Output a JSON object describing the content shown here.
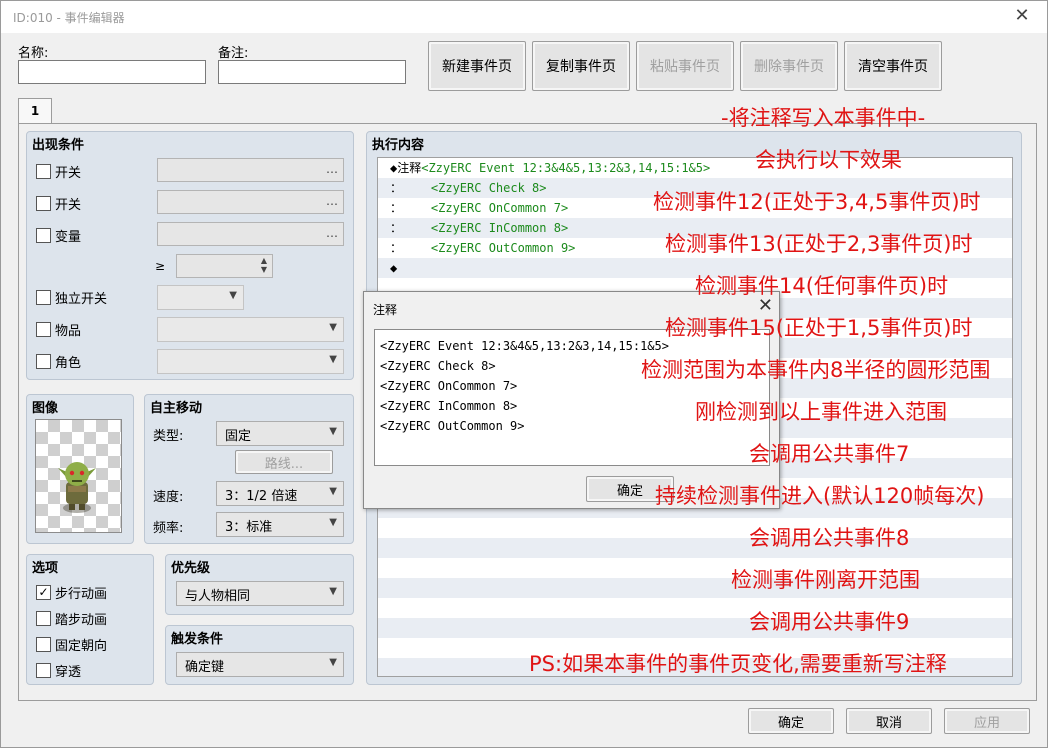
{
  "window": {
    "title": "ID:010 - 事件编辑器"
  },
  "fields": {
    "name_label": "名称:",
    "name_value": "",
    "memo_label": "备注:",
    "memo_value": ""
  },
  "page_buttons": {
    "new": "新建事件页",
    "copy": "复制事件页",
    "paste": "粘贴事件页",
    "delete": "删除事件页",
    "clear": "清空事件页"
  },
  "tab": {
    "label": "1"
  },
  "conditions": {
    "title": "出现条件",
    "switch1": "开关",
    "switch2": "开关",
    "variable": "变量",
    "gte": "≥",
    "self_switch": "独立开关",
    "item": "物品",
    "actor": "角色"
  },
  "image": {
    "title": "图像"
  },
  "autonomous": {
    "title": "自主移动",
    "type_label": "类型:",
    "type_value": "固定",
    "route_button": "路线...",
    "speed_label": "速度:",
    "speed_value": "3：1/2 倍速",
    "freq_label": "频率:",
    "freq_value": "3：标准"
  },
  "options": {
    "title": "选项",
    "walking": "步行动画",
    "stepping": "踏步动画",
    "direction_fix": "固定朝向",
    "through": "穿透"
  },
  "priority": {
    "title": "优先级",
    "value": "与人物相同"
  },
  "trigger": {
    "title": "触发条件",
    "value": "确定键"
  },
  "contents": {
    "title": "执行内容",
    "lines": [
      {
        "head": "◆注释",
        "code": "<ZzyERC Event 12:3&4&5,13:2&3,14,15:1&5>"
      },
      {
        "head": "：    ",
        "code": "<ZzyERC Check 8>"
      },
      {
        "head": "：    ",
        "code": "<ZzyERC OnCommon 7>"
      },
      {
        "head": "：    ",
        "code": "<ZzyERC InCommon 8>"
      },
      {
        "head": "：    ",
        "code": "<ZzyERC OutCommon 9>"
      },
      {
        "head": "◆",
        "code": ""
      }
    ]
  },
  "dialog": {
    "title": "注释",
    "lines": [
      "<ZzyERC Event 12:3&4&5,13:2&3,14,15:1&5>",
      "<ZzyERC Check 8>",
      "<ZzyERC OnCommon 7>",
      "<ZzyERC InCommon 8>",
      "<ZzyERC OutCommon 9>"
    ],
    "ok": "确定"
  },
  "annotations": [
    "-将注释写入本事件中-",
    "会执行以下效果",
    "检测事件12(正处于3,4,5事件页)时",
    "检测事件13(正处于2,3事件页)时",
    "检测事件14(任何事件页)时",
    "检测事件15(正处于1,5事件页)时",
    "检测范围为本事件内8半径的圆形范围",
    "刚检测到以上事件进入范围",
    "会调用公共事件7",
    "持续检测事件进入(默认120帧每次)",
    "会调用公共事件8",
    "检测事件刚离开范围",
    "会调用公共事件9",
    "PS:如果本事件的事件页变化,需要重新写注释"
  ],
  "footer": {
    "ok": "确定",
    "cancel": "取消",
    "apply": "应用"
  },
  "colors": {
    "annotation": "#e01414",
    "code": "#1c8a1c",
    "group_bg": "#dde4ec"
  }
}
